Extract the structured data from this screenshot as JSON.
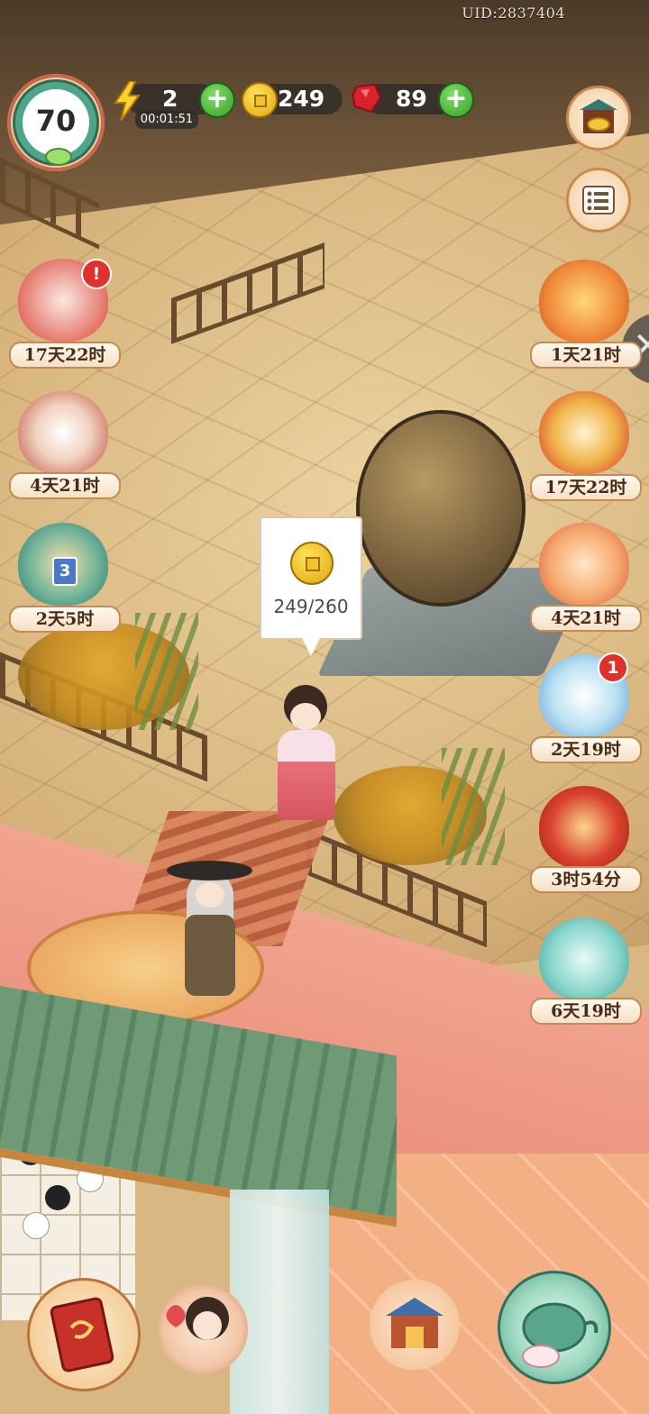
{
  "header": {
    "uid": "UID:2837404",
    "level": "70",
    "energy": {
      "value": "2",
      "timer": "00:01:51",
      "icon": "lightning-icon"
    },
    "coins": {
      "value": "249",
      "icon": "coin-icon"
    },
    "gems": {
      "value": "89",
      "icon": "ruby-icon"
    },
    "plus_symbol": "+"
  },
  "right_buttons": [
    {
      "icon": "treasure-shop-icon"
    },
    {
      "icon": "menu-list-icon"
    }
  ],
  "left_events": [
    {
      "label": "17天22时",
      "icon": "plum-blossom-card-icon",
      "badge": "!"
    },
    {
      "label": "4天21时",
      "icon": "white-bird-icon"
    },
    {
      "label": "2天5时",
      "icon": "pavilion-level-3-icon",
      "pavilion_number": "3"
    }
  ],
  "right_events": [
    {
      "label": "1天21时",
      "icon": "jade-scepter-icon"
    },
    {
      "label": "17天22时",
      "icon": "red-envelope-fan-icon"
    },
    {
      "label": "4天21时",
      "icon": "lucky-cat-icon"
    },
    {
      "label": "2天19时",
      "icon": "cloud-cat-icon",
      "badge": "1"
    },
    {
      "label": "3时54分",
      "icon": "red-gift-box-icon"
    },
    {
      "label": "6天19时",
      "icon": "blue-gift-box-icon"
    }
  ],
  "coin_bubble": {
    "text": "249/260"
  },
  "close_symbol": "✕",
  "bottom_bar": [
    {
      "icon": "red-book-icon"
    },
    {
      "icon": "character-portrait-icon"
    },
    {
      "icon": "shop-building-icon"
    },
    {
      "icon": "teapot-rabbit-icon"
    }
  ],
  "colors": {
    "accent_green": "#3a9d2e",
    "badge_red": "#e0312c",
    "label_text": "#4a2a16"
  }
}
